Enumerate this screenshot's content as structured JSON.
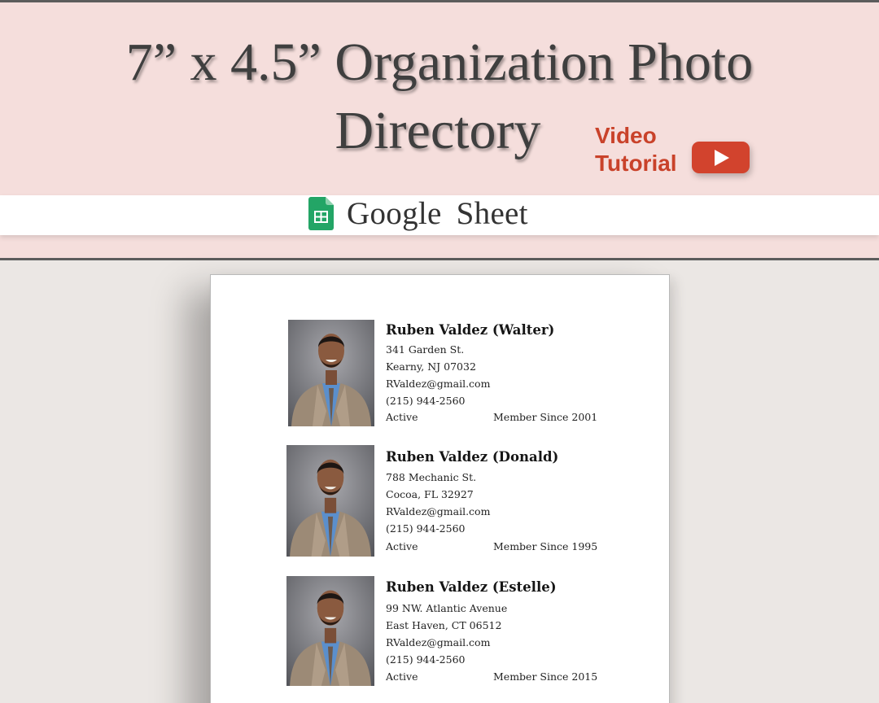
{
  "header": {
    "title_line1": "7” x 4.5” Organization Photo",
    "title_line2": "Directory",
    "video_line1": "Video",
    "video_line2": "Tutorial",
    "sheet_label": "Google  Sheet",
    "colors": {
      "banner": "#f5dedc",
      "accent": "#c9422a",
      "sheets_green": "#23a566"
    }
  },
  "directory": {
    "entries": [
      {
        "name": "Ruben Valdez (Walter)",
        "street": "341 Garden St.",
        "city": "Kearny, NJ 07032",
        "email": "RValdez@gmail.com",
        "phone": "(215) 944-2560",
        "status": "Active",
        "member_since": "Member Since 2001"
      },
      {
        "name": "Ruben Valdez (Donald)",
        "street": "788 Mechanic St.",
        "city": "Cocoa, FL 32927",
        "email": "RValdez@gmail.com",
        "phone": "(215) 944-2560",
        "status": "Active",
        "member_since": "Member Since 1995"
      },
      {
        "name": "Ruben Valdez (Estelle)",
        "street": "99 NW. Atlantic Avenue",
        "city": "East Haven, CT 06512",
        "email": "RValdez@gmail.com",
        "phone": "(215) 944-2560",
        "status": "Active",
        "member_since": "Member Since 2015"
      }
    ]
  }
}
